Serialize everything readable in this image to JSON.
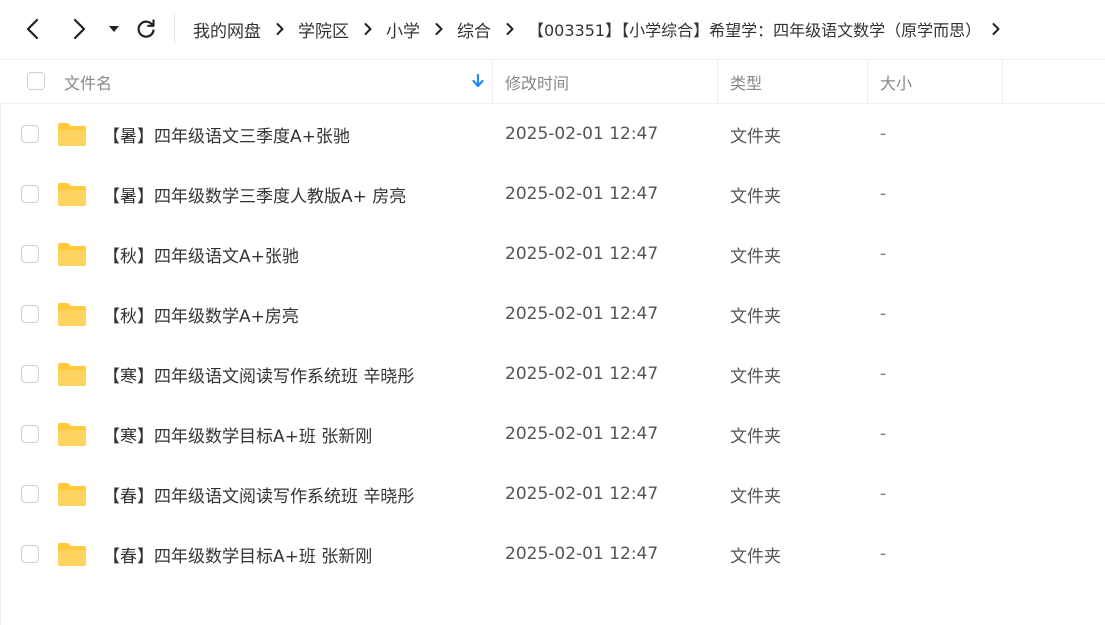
{
  "nav": {
    "back_icon": "chevron-left-icon",
    "forward_icon": "chevron-right-icon",
    "history_icon": "caret-down-icon",
    "refresh_icon": "refresh-icon"
  },
  "breadcrumb": {
    "separator_icon": "chevron-right-icon",
    "items": [
      "我的网盘",
      "学院区",
      "小学",
      "综合",
      "【003351】【小学综合】希望学：四年级语文数学（原学而思）"
    ]
  },
  "table": {
    "columns": {
      "name": "文件名",
      "modified": "修改时间",
      "type": "类型",
      "size": "大小"
    },
    "sort_icon": "arrow-down-icon",
    "accent_color": "#1e8cf0",
    "folder_color": "#ffc83d",
    "rows": [
      {
        "name": "【暑】四年级语文三季度A+张驰",
        "modified": "2025-02-01 12:47",
        "type": "文件夹",
        "size": "-"
      },
      {
        "name": "【暑】四年级数学三季度人教版A+ 房亮",
        "modified": "2025-02-01 12:47",
        "type": "文件夹",
        "size": "-"
      },
      {
        "name": "【秋】四年级语文A+张驰",
        "modified": "2025-02-01 12:47",
        "type": "文件夹",
        "size": "-"
      },
      {
        "name": "【秋】四年级数学A+房亮",
        "modified": "2025-02-01 12:47",
        "type": "文件夹",
        "size": "-"
      },
      {
        "name": "【寒】四年级语文阅读写作系统班  辛晓彤",
        "modified": "2025-02-01 12:47",
        "type": "文件夹",
        "size": "-"
      },
      {
        "name": "【寒】四年级数学目标A+班  张新刚",
        "modified": "2025-02-01 12:47",
        "type": "文件夹",
        "size": "-"
      },
      {
        "name": "【春】四年级语文阅读写作系统班  辛晓彤",
        "modified": "2025-02-01 12:47",
        "type": "文件夹",
        "size": "-"
      },
      {
        "name": "【春】四年级数学目标A+班  张新刚",
        "modified": "2025-02-01 12:47",
        "type": "文件夹",
        "size": "-"
      }
    ]
  }
}
